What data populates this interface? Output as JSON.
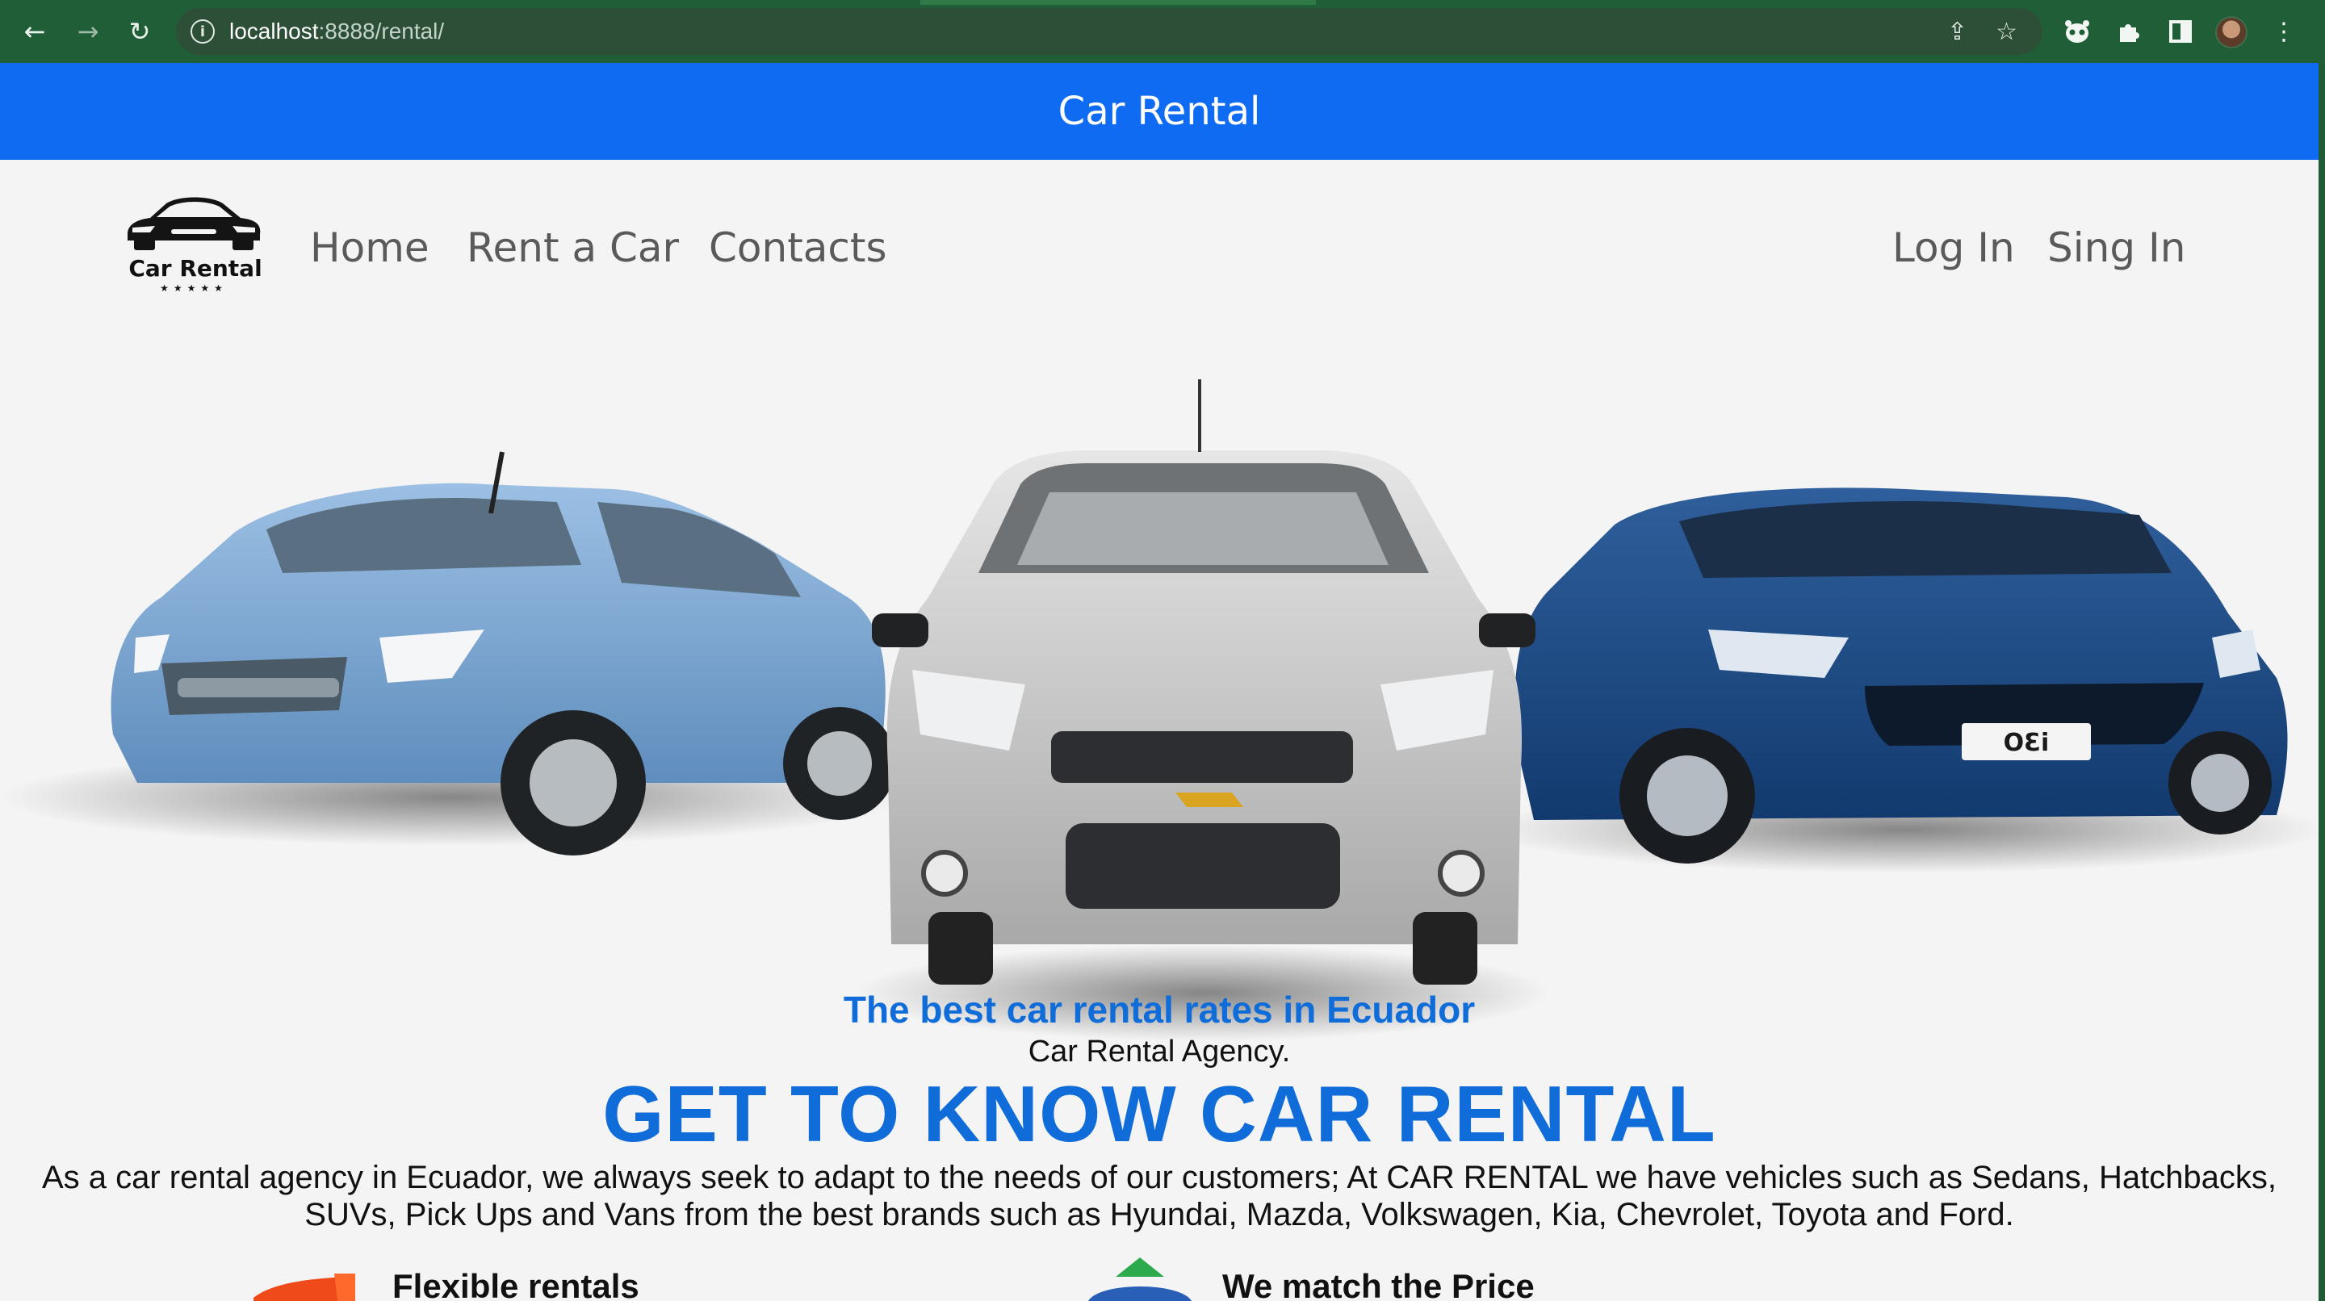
{
  "browser": {
    "url_host": "localhost",
    "url_rest": ":8888/rental/",
    "icons": [
      "back-icon",
      "forward-icon",
      "reload-icon",
      "info-icon",
      "share-icon",
      "star-icon",
      "extension-icon",
      "puzzle-icon",
      "sidepanel-icon",
      "profile-avatar",
      "menu-icon"
    ]
  },
  "banner": {
    "title": "Car Rental"
  },
  "logo": {
    "text": "Car Rental",
    "stars": "★★★★★"
  },
  "nav": {
    "home": "Home",
    "rent": "Rent a Car",
    "contacts": "Contacts"
  },
  "auth": {
    "login": "Log In",
    "signin": "Sing In"
  },
  "hero": {
    "headline": "The best car rental rates in Ecuador",
    "subtitle": "Car Rental Agency.",
    "title": "GET TO KNOW CAR RENTAL",
    "description": "As a car rental agency in Ecuador, we always seek to adapt to the needs of our customers; At CAR RENTAL we have vehicles such as Sedans, Hatchbacks, SUVs, Pick Ups and Vans from the best brands such as Hyundai, Mazda, Volkswagen, Kia, Chevrolet, Toyota and Ford."
  },
  "features": [
    {
      "label": "Flexible rentals"
    },
    {
      "label": "We match the Price"
    }
  ],
  "colors": {
    "brand_blue": "#0f6cf2",
    "heading_blue": "#0f6cd8",
    "chrome_green": "#1f5e36"
  }
}
